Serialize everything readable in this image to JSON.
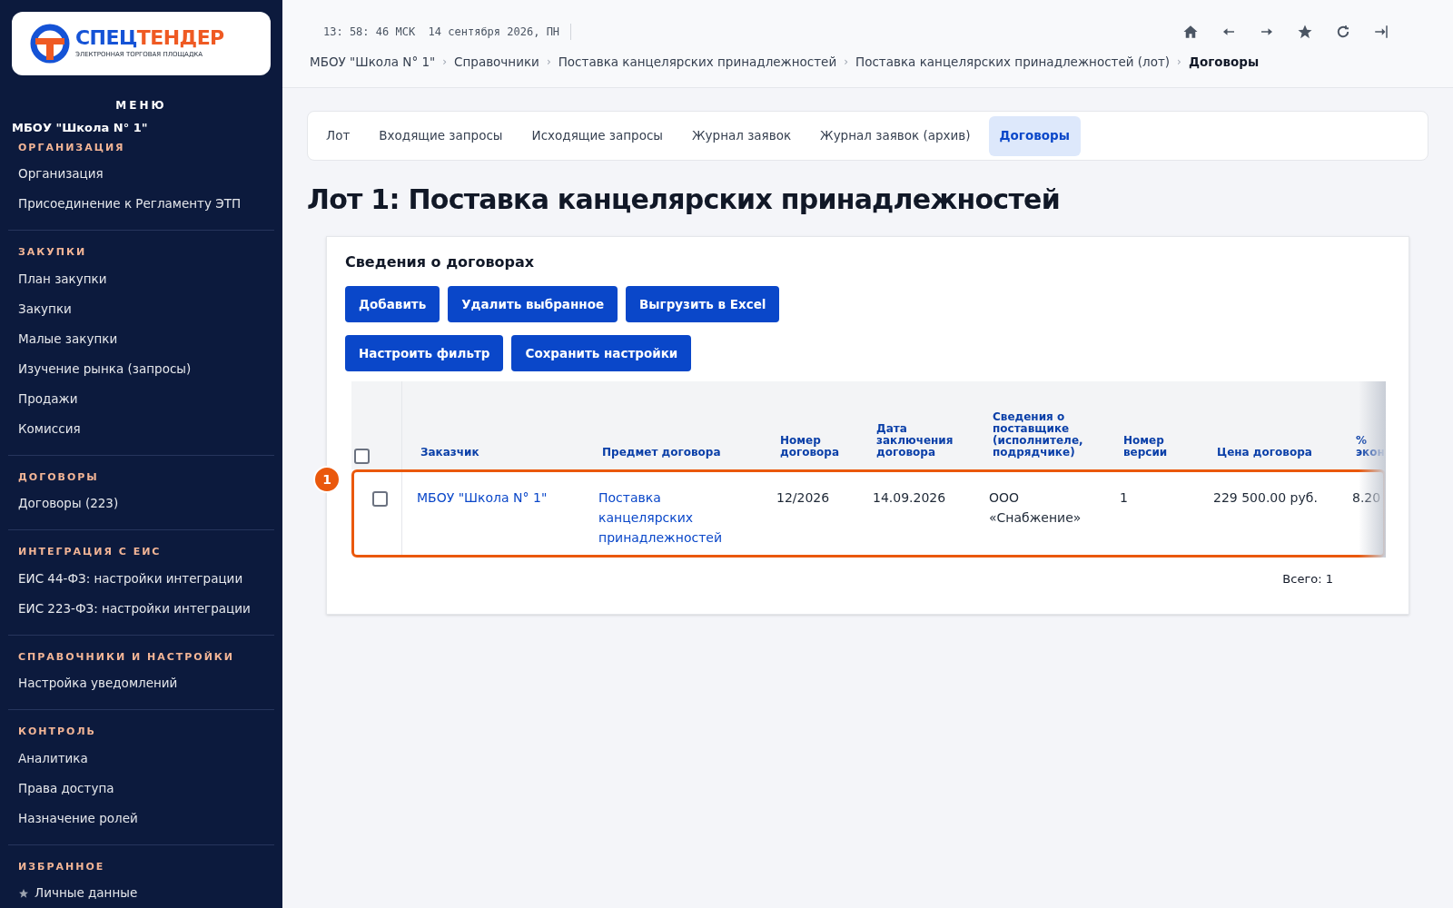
{
  "logo": {
    "brand_first": "СПЕЦ",
    "brand_second": "ТЕНДЕР",
    "subtitle": "ЭЛЕКТРОННАЯ ТОРГОВАЯ ПЛОЩАДКА"
  },
  "sidebar": {
    "title": "МЕНЮ",
    "organization": "МБОУ \"Школа N° 1\"",
    "sections": [
      {
        "heading": "ОРГАНИЗАЦИЯ",
        "items": [
          {
            "label": "Организация"
          },
          {
            "label": "Присоединение к Регламенту ЭТП"
          }
        ]
      },
      {
        "heading": "ЗАКУПКИ",
        "items": [
          {
            "label": "План закупки"
          },
          {
            "label": "Закупки"
          },
          {
            "label": "Малые закупки"
          },
          {
            "label": "Изучение рынка (запросы)"
          },
          {
            "label": "Продажи"
          },
          {
            "label": "Комиссия"
          }
        ]
      },
      {
        "heading": "ДОГОВОРЫ",
        "items": [
          {
            "label": "Договоры (223)"
          }
        ]
      },
      {
        "heading": "ИНТЕГРАЦИЯ С ЕИС",
        "items": [
          {
            "label": "ЕИС 44-ФЗ: настройки интеграции"
          },
          {
            "label": "ЕИС 223-ФЗ: настройки интеграции"
          }
        ]
      },
      {
        "heading": "СПРАВОЧНИКИ И НАСТРОЙКИ",
        "items": [
          {
            "label": "Настройка уведомлений"
          }
        ]
      },
      {
        "heading": "КОНТРОЛЬ",
        "items": [
          {
            "label": "Аналитика"
          },
          {
            "label": "Права доступа"
          },
          {
            "label": "Назначение ролей"
          }
        ]
      },
      {
        "heading": "ИЗБРАННОЕ",
        "items": [
          {
            "label": "Личные данные",
            "starred": true
          }
        ]
      }
    ]
  },
  "header": {
    "clock": "13: 58: 46 МСК  14 сентября 2026, ПН",
    "breadcrumb_separator": "›",
    "breadcrumbs": [
      {
        "label": "МБОУ \"Школа N° 1\"",
        "current": false
      },
      {
        "label": "Справочники",
        "current": false
      },
      {
        "label": "Поставка канцелярских принадлежностей",
        "current": false
      },
      {
        "label": "Поставка канцелярских принадлежностей (лот)",
        "current": false
      },
      {
        "label": "Договоры",
        "current": true
      }
    ],
    "toolbar": [
      {
        "kind": "home"
      },
      {
        "kind": "back"
      },
      {
        "kind": "forward"
      },
      {
        "kind": "star"
      },
      {
        "kind": "refresh"
      },
      {
        "kind": "logout"
      }
    ]
  },
  "tabs": [
    {
      "label": "Лот",
      "selected": false
    },
    {
      "label": "Входящие запросы",
      "selected": false
    },
    {
      "label": "Исходящие запросы",
      "selected": false
    },
    {
      "label": "Журнал заявок",
      "selected": false
    },
    {
      "label": "Журнал заявок (архив)",
      "selected": false
    },
    {
      "label": "Договоры",
      "selected": true
    }
  ],
  "page_title": "Лот 1: Поставка канцелярских принадлежностей",
  "card": {
    "title": "Сведения о договорах",
    "buttons": [
      [
        "Добавить",
        "Удалить выбранное",
        "Выгрузить в Excel"
      ],
      [
        "Настроить фильтр",
        "Сохранить настройки"
      ]
    ],
    "table": {
      "select_all_checked": false,
      "columns": [
        "Заказчик",
        "Предмет договора",
        "Номер договора",
        "Дата заключения договора",
        "Сведения о поставщике (исполнителе, подрядчике)",
        "Номер версии",
        "Цена договора",
        "% экон"
      ],
      "rows": [
        {
          "checked": false,
          "highlighted": true,
          "callout": "1",
          "cells": [
            "МБОУ \"Школа N° 1\"",
            "Поставка канцелярских принадлежностей",
            "12/2026",
            "14.09.2026",
            "ООО «Снабжение»",
            "1",
            "229 500.00 руб.",
            "8.20"
          ]
        }
      ]
    },
    "total": "Всего: 1"
  }
}
